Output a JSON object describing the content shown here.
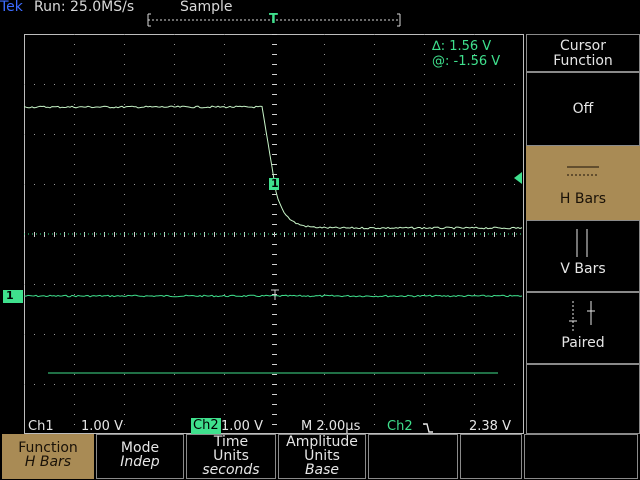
{
  "status": {
    "brand": "Tek",
    "run_info": "Run: 25.0MS/s",
    "acquisition_mode": "Sample",
    "trigger_marker": "T"
  },
  "cursor_readout": {
    "delta": "∆: 1.56 V",
    "at": "@: -1.56 V"
  },
  "channel_readout": {
    "ch1_label": "Ch1",
    "ch1_scale": "1.00 V",
    "ch2_label": "Ch2",
    "ch2_scale": "1.00 V",
    "timebase": "M 2.00µs",
    "trigger_source": "Ch2",
    "trigger_slope_icon": "falling-edge-icon",
    "trigger_level": "2.38 V"
  },
  "markers": {
    "ch2_ground": "1",
    "cursor_marker": "1"
  },
  "side_menu": {
    "title_line1": "Cursor",
    "title_line2": "Function",
    "items": [
      {
        "label": "Off"
      },
      {
        "label": "H Bars",
        "selected": true
      },
      {
        "label": "V Bars"
      },
      {
        "label": "Paired"
      }
    ]
  },
  "bottom_menu": [
    {
      "line1": "Function",
      "line2": "H Bars",
      "selected": true
    },
    {
      "line1": "Mode",
      "line2": "Indep"
    },
    {
      "line1": "Time",
      "line2": "Units",
      "line3": "seconds"
    },
    {
      "line1": "Amplitude",
      "line2": "Units",
      "line3": "Base"
    },
    {
      "line1": ""
    },
    {
      "line1": ""
    },
    {
      "line1": ""
    }
  ],
  "colors": {
    "trace": "#3fe08d",
    "graticule": "#bdbdbd",
    "brand": "#3d6cff",
    "selected_menu": "#a98b55"
  }
}
